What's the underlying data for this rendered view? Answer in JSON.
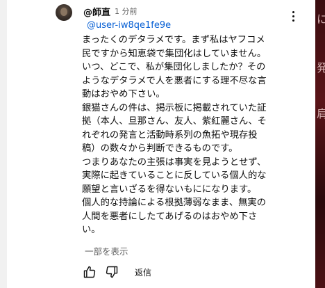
{
  "comment": {
    "author": "@師直",
    "timestamp": "1 分前",
    "mention": "@user-iw8qe1fe9e",
    "lines": [
      "まったくのデタラメです。まず私はヤフコメ",
      "民ですから知恵袋で集団化はしていません。",
      "いつ、どこで、私が集団化しましたか？その",
      "ようなデタラメで人を悪者にする理不尽な言",
      "動はおやめ下さい。",
      "銀猫さんの件は、掲示板に掲載されていた証",
      "拠（本人、旦那さん、友人、紫紅麗さん、そ",
      "れぞれの発言と活動時系列の魚拓や現存投",
      "稿）の数々から判断できるものです。",
      "つまりあなたの主張は事実を見ようとせず、",
      "実際に起きていることに反している個人的な",
      "願望と言いざるを得ないもにになります。",
      "個人的な持論による根拠薄弱なまま、無実の",
      "人間を悪者にしたてあげるのはおやめ下さ",
      "い。"
    ],
    "read_more": "一部を表示",
    "reply_label": "返信"
  },
  "icons": {
    "like": "thumb-up-icon",
    "dislike": "thumb-down-icon",
    "menu": "more-vert-icon"
  },
  "colors": {
    "mention": "#065fd4",
    "secondary_text": "#606060"
  }
}
